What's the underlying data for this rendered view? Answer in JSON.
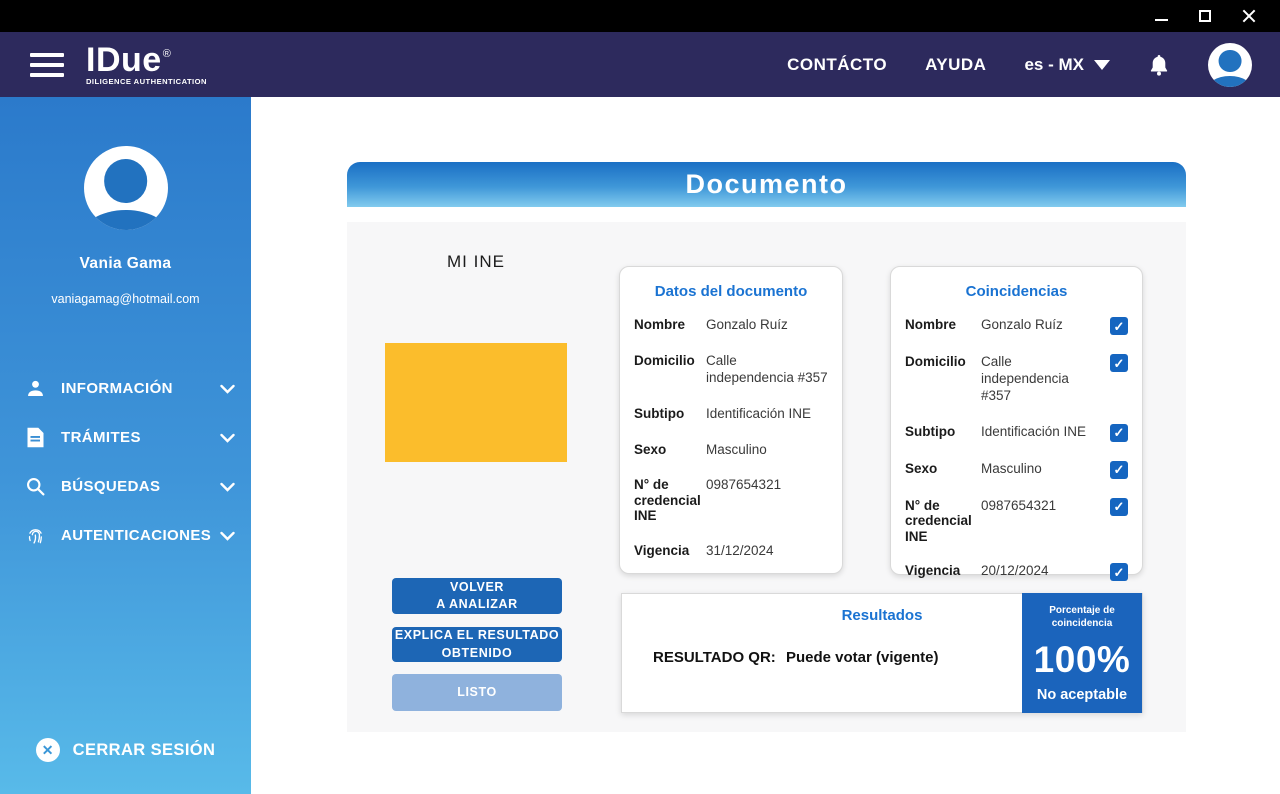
{
  "titlebar": {
    "controls": [
      "minimize",
      "maximize",
      "close"
    ]
  },
  "header": {
    "logo": {
      "title": "IDue",
      "registered": "®",
      "subtitle": "DILIGENCE AUTHENTICATION"
    },
    "links": [
      {
        "label": "CONTÁCTO"
      },
      {
        "label": "AYUDA"
      }
    ],
    "language": "es - MX",
    "icons": [
      "bell-icon",
      "user-avatar"
    ]
  },
  "sidebar": {
    "user": {
      "name": "Vania Gama",
      "email": "vaniagamag@hotmail.com"
    },
    "items": [
      {
        "label": "INFORMACIÓN",
        "icon": "person-icon"
      },
      {
        "label": "TRÁMITES",
        "icon": "document-icon"
      },
      {
        "label": "BÚSQUEDAS",
        "icon": "search-icon"
      },
      {
        "label": "AUTENTICACIONES",
        "icon": "fingerprint-icon"
      }
    ],
    "logout": {
      "label": "CERRAR SESIÓN",
      "icon": "x-circle-icon"
    }
  },
  "main": {
    "title": "Documento",
    "document_label": "MI INE",
    "datos": {
      "title": "Datos del documento",
      "rows": [
        {
          "label": "Nombre",
          "value": "Gonzalo Ruíz"
        },
        {
          "label": "Domicilio",
          "value": "Calle independencia #357"
        },
        {
          "label": "Subtipo",
          "value": "Identificación INE"
        },
        {
          "label": "Sexo",
          "value": "Masculino"
        },
        {
          "label": "N° de credencial INE",
          "value": "0987654321"
        },
        {
          "label": "Vigencia",
          "value": "31/12/2024"
        }
      ]
    },
    "coincidencias": {
      "title": "Coincidencias",
      "rows": [
        {
          "label": "Nombre",
          "value": "Gonzalo Ruíz",
          "checked": true
        },
        {
          "label": "Domicilio",
          "value": "Calle independencia #357",
          "checked": true
        },
        {
          "label": "Subtipo",
          "value": "Identificación INE",
          "checked": true
        },
        {
          "label": "Sexo",
          "value": "Masculino",
          "checked": true
        },
        {
          "label": "N° de credencial INE",
          "value": "0987654321",
          "checked": true
        },
        {
          "label": "Vigencia",
          "value": "20/12/2024",
          "checked": true
        }
      ]
    },
    "buttons": {
      "volver": "VOLVER\nA ANALIZAR",
      "explica": "EXPLICA EL RESULTADO\nOBTENIDO",
      "listo": "LISTO"
    },
    "resultados": {
      "title": "Resultados",
      "result_label": "RESULTADO QR:",
      "result_value": "Puede votar (vigente)",
      "percent_label": "Porcentaje de\ncoincidencia",
      "percent": "100%",
      "status": "No aceptable"
    }
  },
  "colors": {
    "header_navy": "#2d2a5d",
    "sidebar_gradient_top": "#2b7acb",
    "sidebar_gradient_bottom": "#58bae9",
    "banner_gradient_top": "#1a6fc4",
    "banner_gradient_bottom": "#82cbee",
    "accent_blue": "#1a73d2",
    "checkbox_blue": "#1565c0",
    "button_blue": "#1d66b5",
    "button_disabled": "#8fb2dd",
    "percent_block_blue": "#1b64bc",
    "document_placeholder_yellow": "#fbbd2c",
    "panel_gray": "#f7f7f8"
  }
}
